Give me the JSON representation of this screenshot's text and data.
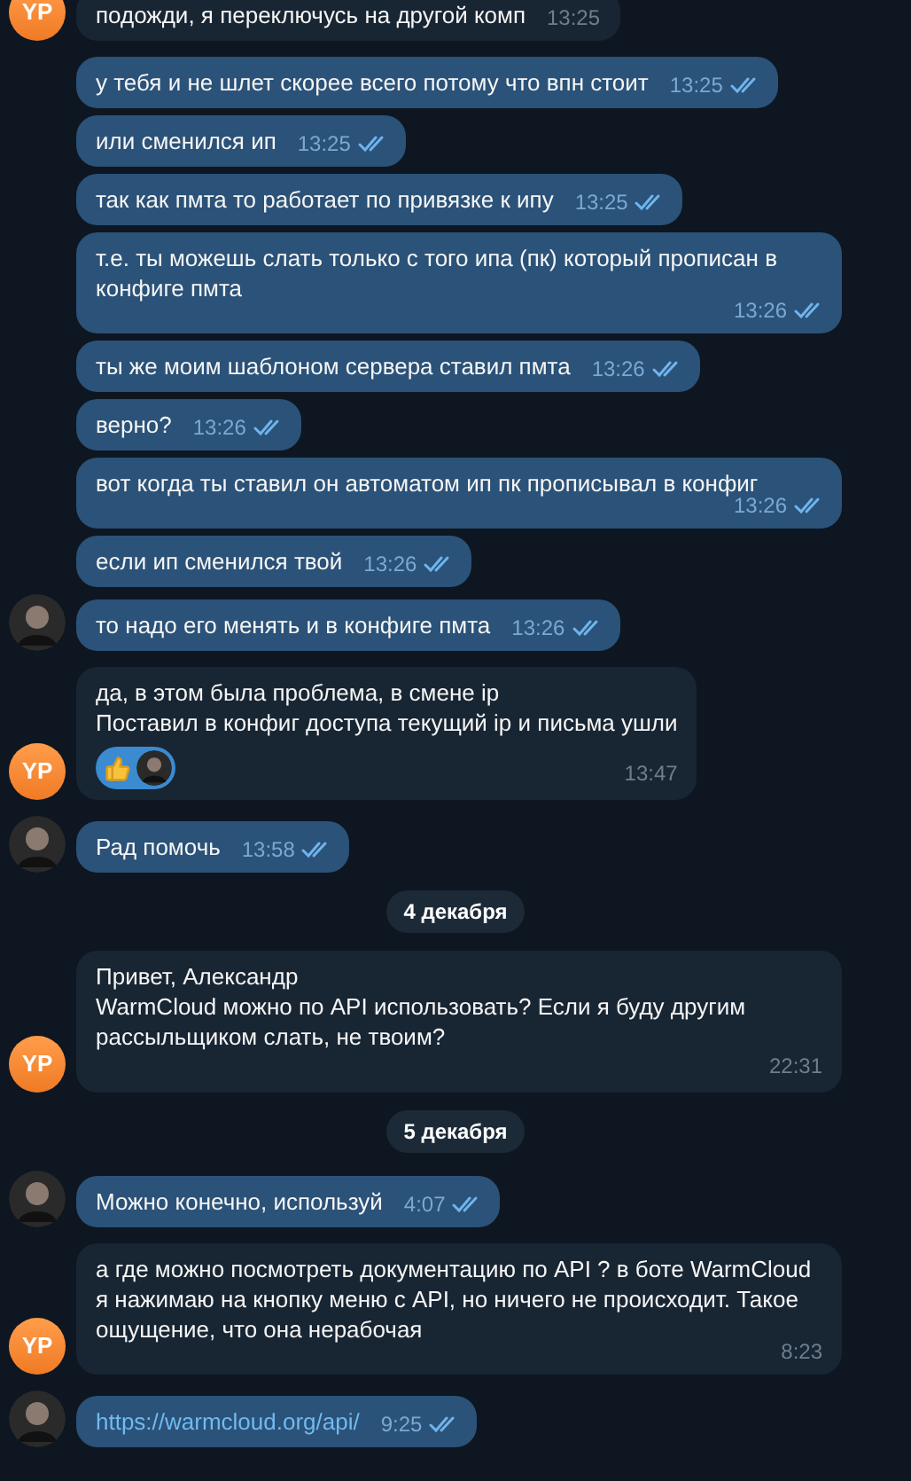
{
  "messages": [
    {
      "kind": "message",
      "outgoing": false,
      "text": "подожди, я переключусь на другой комп",
      "time": "13:25",
      "avatar": {
        "kind": "initials",
        "text": "YP"
      }
    },
    {
      "kind": "message",
      "outgoing": true,
      "text": "у тебя и не шлет скорее всего потому что впн стоит",
      "time": "13:25",
      "read": true
    },
    {
      "kind": "message",
      "outgoing": true,
      "text": "или сменился ип",
      "time": "13:25",
      "read": true
    },
    {
      "kind": "message",
      "outgoing": true,
      "text": "так как пмта то работает по привязке к ипу",
      "time": "13:25",
      "read": true
    },
    {
      "kind": "message",
      "outgoing": true,
      "text": "т.е. ты можешь слать только с того ипа (пк) который прописан в конфиге пмта",
      "time": "13:26",
      "read": true
    },
    {
      "kind": "message",
      "outgoing": true,
      "text": "ты же моим шаблоном сервера ставил пмта",
      "time": "13:26",
      "read": true
    },
    {
      "kind": "message",
      "outgoing": true,
      "text": "верно?",
      "time": "13:26",
      "read": true
    },
    {
      "kind": "message",
      "outgoing": true,
      "text": "вот когда ты ставил он автоматом ип пк прописывал в конфиг",
      "time": "13:26",
      "read": true
    },
    {
      "kind": "message",
      "outgoing": true,
      "text": "если ип сменился твой",
      "time": "13:26",
      "read": true
    },
    {
      "kind": "message",
      "outgoing": true,
      "text": "то надо его менять и в конфиге пмта",
      "time": "13:26",
      "read": true,
      "avatar": {
        "kind": "photo"
      }
    },
    {
      "kind": "message",
      "outgoing": false,
      "lines": [
        "да, в этом была проблема, в смене ip",
        "Поставил в конфиг доступа текущий ip и письма ушли"
      ],
      "time": "13:47",
      "reaction": {
        "kind": "thumbs-up"
      },
      "avatar": {
        "kind": "initials",
        "text": "YP"
      }
    },
    {
      "kind": "message",
      "outgoing": true,
      "text": "Рад помочь",
      "time": "13:58",
      "read": true,
      "avatar": {
        "kind": "photo"
      }
    },
    {
      "kind": "date",
      "text": "4 декабря"
    },
    {
      "kind": "message",
      "outgoing": false,
      "lines": [
        "Привет, Александр",
        "WarmCloud можно по API использовать? Если я буду другим рассыльщиком слать, не твоим?"
      ],
      "time": "22:31",
      "avatar": {
        "kind": "initials",
        "text": "YP"
      }
    },
    {
      "kind": "date",
      "text": "5 декабря"
    },
    {
      "kind": "message",
      "outgoing": true,
      "text": "Можно конечно, используй",
      "time": "4:07",
      "read": true,
      "avatar": {
        "kind": "photo"
      }
    },
    {
      "kind": "message",
      "outgoing": false,
      "text": "а где можно посмотреть документацию по API ? в боте WarmCloud я нажимаю на кнопку меню с API, но ничего не происходит. Такое ощущение, что она нерабочая",
      "time": "8:23",
      "avatar": {
        "kind": "initials",
        "text": "YP"
      }
    },
    {
      "kind": "message",
      "outgoing": true,
      "text": "https://warmcloud.org/api/",
      "link": true,
      "time": "9:25",
      "read": true,
      "avatar": {
        "kind": "photo"
      }
    }
  ]
}
